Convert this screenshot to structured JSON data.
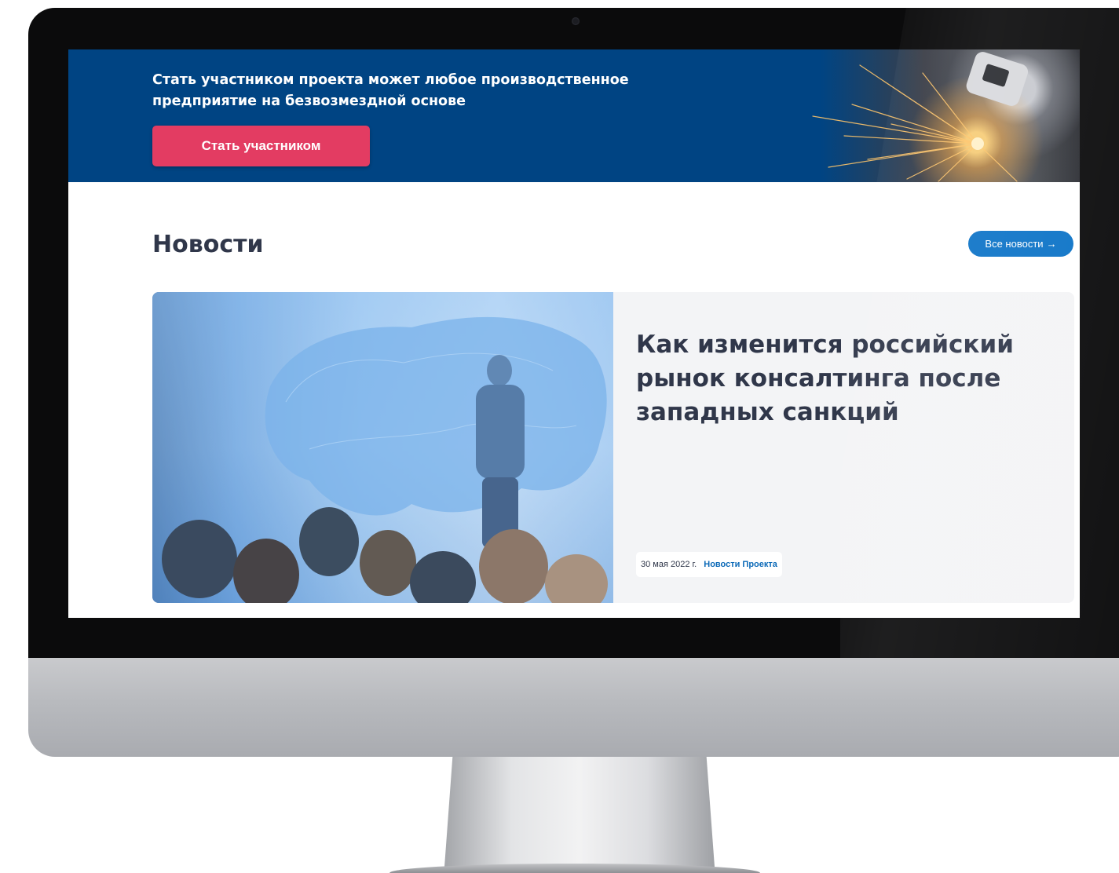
{
  "hero": {
    "text": "Стать участником проекта может любое производственное предприятие на безвозмездной основе",
    "cta_label": "Стать участником"
  },
  "news": {
    "title": "Новости",
    "all_news_label": "Все новости",
    "all_news_arrow": "→",
    "featured": {
      "headline": "Как изменится российский рынок консалтинга после западных санкций",
      "date": "30 мая 2022 г.",
      "category": "Новости Проекта"
    }
  },
  "colors": {
    "hero_background": "#004483",
    "cta_button": "#e33c62",
    "link_button": "#0c73c7",
    "heading_text": "#30374a",
    "card_background": "#f3f4f6",
    "category_link": "#0c6ab8"
  }
}
